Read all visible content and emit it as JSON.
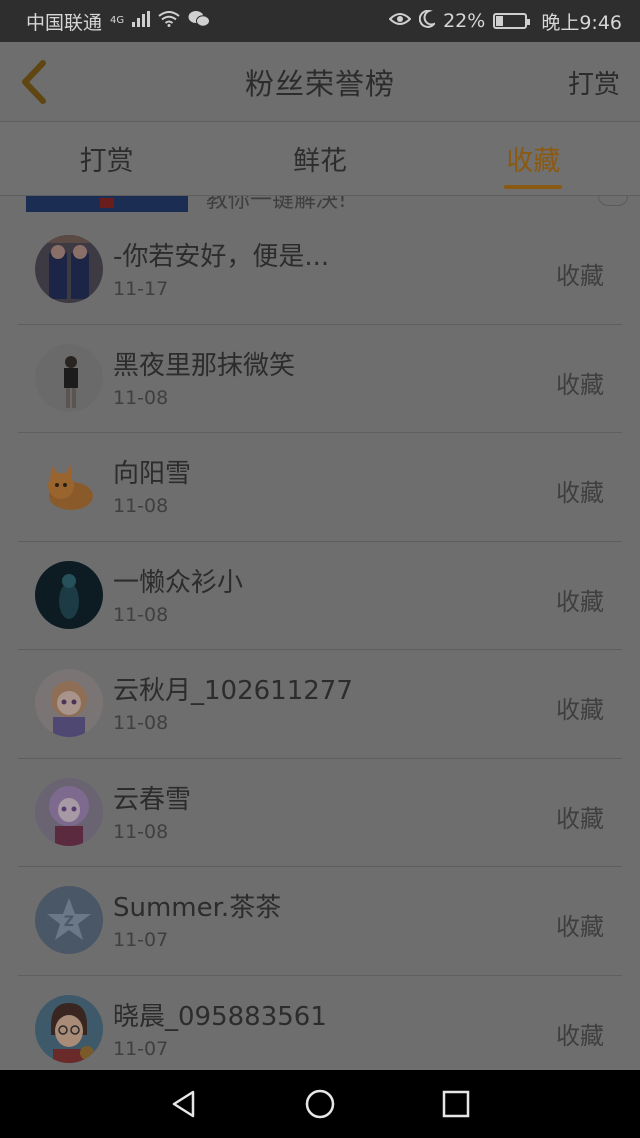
{
  "status_bar": {
    "carrier": "中国联通",
    "network": "4G",
    "battery": "22%",
    "battery_level": 0.22,
    "time": "晚上9:46"
  },
  "app_bar": {
    "title": "粉丝荣誉榜",
    "action": "打赏"
  },
  "tabs": [
    {
      "label": "打赏",
      "active": false
    },
    {
      "label": "鲜花",
      "active": false
    },
    {
      "label": "收藏",
      "active": true
    }
  ],
  "ad": {
    "text": "教你一键解决!"
  },
  "list": [
    {
      "name": "-你若安好，便是...",
      "date": "11-17",
      "status": "收藏"
    },
    {
      "name": "黑夜里那抹微笑",
      "date": "11-08",
      "status": "收藏"
    },
    {
      "name": "向阳雪",
      "date": "11-08",
      "status": "收藏"
    },
    {
      "name": "一懒众衫小",
      "date": "11-08",
      "status": "收藏"
    },
    {
      "name": "云秋月_102611277",
      "date": "11-08",
      "status": "收藏"
    },
    {
      "name": "云春雪",
      "date": "11-08",
      "status": "收藏"
    },
    {
      "name": "Summer.茶茶",
      "date": "11-07",
      "status": "收藏"
    },
    {
      "name": "晓晨_095883561",
      "date": "11-07",
      "status": "收藏"
    }
  ],
  "colors": {
    "accent": "#8a5a12",
    "overlay_bg": "#6e6e6e",
    "statusbar_bg": "#2e2e2e",
    "navbar_bg": "#000000"
  },
  "icons": {
    "back": "chevron-left-icon",
    "nav_back": "triangle-back-icon",
    "nav_home": "circle-home-icon",
    "nav_recent": "square-recent-icon"
  }
}
